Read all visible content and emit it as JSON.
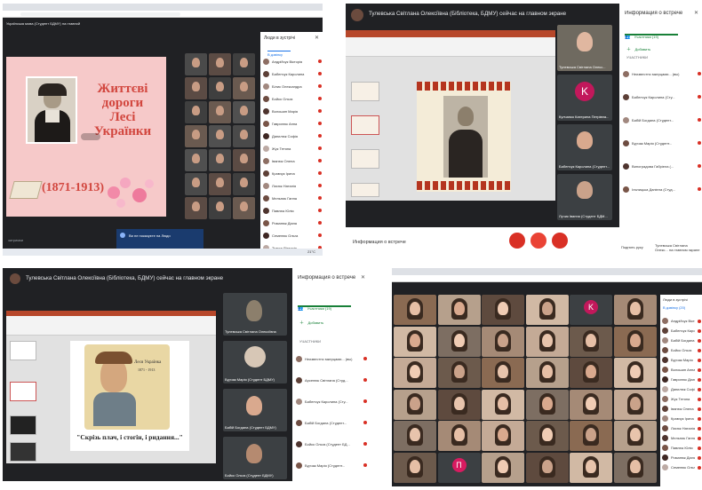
{
  "q1": {
    "meeting_title": "Українська мова (Студент БДМУ) на главной",
    "sidebar_title": "Люди в зустрічі",
    "in_call_label": "В дзвінку",
    "slide": {
      "title_line1": "Життєві",
      "title_line2": "дороги",
      "title_line3": "Лесі",
      "title_line4": "Українки",
      "years": "(1871-1913)"
    },
    "participants": [
      "Андрійчук Вікторія",
      "Бабенчук Каролина",
      "Білик Олександра",
      "Бойко Ольга",
      "Волошин Марія",
      "Гаврилюк Анна",
      "Данилюк Софія",
      "Жук Тетяна",
      "Іванюк Олена",
      "Кравчук Ірина",
      "Лисюк Наталія",
      "Мельник Ганна",
      "Павлюк Юлія",
      "Романюк Діана",
      "Семенюк Ольга",
      "Ткачук Вікторія"
    ],
    "notification": "Ви не показуєте на Люди",
    "bottom_left": "затримки",
    "weather": "21°C"
  },
  "q2": {
    "presenter_banner": "Тулевська Світлана Олексіївна (Бібліотека, БДМУ) сейчас на главном экране",
    "info_title": "Информация о встрече",
    "participants_tab": "Участники (19)",
    "add_label": "Добавить",
    "section_label": "УЧАСТНИКИ",
    "list": [
      "Неизвестно мкерцами... (вы)",
      "Бабенчук Каролина (Сту...",
      "Бабій Богдана (Студент...",
      "Бурчак Марія (Студент...",
      "Виноградова Габріела (...",
      "Ільницька Даніела (Студ..."
    ],
    "tiles": [
      "Тулевська Світлана Олекс...",
      "Кулчанко Катерина Петрівна...",
      "Бабенчук Каролина (Студент...",
      "Лучик Іванна (Студент БДМ..."
    ],
    "tile_k_letter": "K",
    "info_bottom": "Информация о встрече",
    "raise_hand": "Поднять руку",
    "presenter_bottom": "Тулевська Світлана Олекс... на главном экране"
  },
  "q3": {
    "presenter_banner": "Тулевська Світлана Олексіївна (Бібліотека, БДМУ) сейчас на главном экране",
    "info_title": "Информация о встрече",
    "participants_tab": "Участники (19)",
    "add_label": "Добавить",
    "section_label": "УЧАСТНИКИ",
    "list": [
      "Неизвестно мкерцами... (вы)",
      "Арсенюк Світлана (Студ...",
      "Бабенчук Каролина (Сту...",
      "Бабій Богдана (Студент...",
      "Бойко Ольга (Студент БД...",
      "Бурчак Марія (Студент..."
    ],
    "slide_name": "Леся Українка",
    "slide_years": "1871 - 1913",
    "slide_quote": "\"Скрізь плач, і стогін, і ридання...\"",
    "tiles": [
      "Тулевська Світлана Олексіївна",
      "Бурчак Марія (Студент БДМУ)",
      "Бабій Богдана (Студент БДМУ)",
      "Бойко Ольга (Студент БДМУ)"
    ]
  },
  "q4": {
    "sidebar_title": "Люди в зустрічі",
    "tab_label": "В дзвінку (20)",
    "tile_letters": [
      "K",
      "П"
    ],
    "participants": [
      "Андрійчук Вікторія",
      "Бабенчук Каролина",
      "Бабій Богдана",
      "Бойко Ольга",
      "Бурчак Марія",
      "Волошин Анна",
      "Гаврилюк Діана",
      "Данилюк Софія",
      "Жук Тетяна",
      "Іванюк Олена",
      "Кравчук Ірина",
      "Лисюк Наталія",
      "Мельник Ганна",
      "Павлюк Юлія",
      "Романюк Діана",
      "Семенюк Ольга"
    ]
  }
}
